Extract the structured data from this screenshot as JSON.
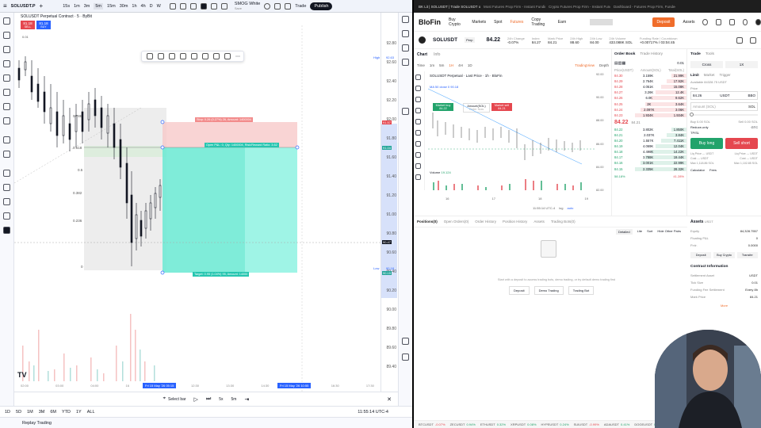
{
  "left": {
    "symbol": "SOLUSDT.P",
    "timeframes": [
      "15s",
      "1m",
      "3m",
      "5m",
      "15m",
      "30m",
      "1h",
      "4h",
      "D",
      "W"
    ],
    "template": "SMOG White",
    "template_sub": "Save",
    "trade_label": "Trade",
    "publish_label": "Publish",
    "legend_title": "SOLUSDT Perpetual Contract · 5 · ByBit",
    "sell_price": "81.18",
    "sell_label": "SELL",
    "buy_price": "81.18",
    "buy_label": "BUY",
    "spread": "0.01",
    "price_labels": [
      "92.80",
      "92.60",
      "92.40",
      "92.20",
      "92.00",
      "91.80",
      "91.60",
      "91.40",
      "91.20",
      "91.00",
      "90.80",
      "90.60",
      "90.40",
      "90.20",
      "90.00",
      "89.80",
      "89.60",
      "89.40"
    ],
    "high_label": "High",
    "high_price": "92.63",
    "low_label": "Low",
    "low_price": "90.18",
    "tag_prices": [
      "91.57",
      "91.04",
      "90.47",
      "90.15"
    ],
    "fib_levels": [
      "0.786",
      "0.618",
      "0.5",
      "0.382",
      "0.236",
      "0"
    ],
    "stop_text": "Stop: 0.26 (0.27%) 26, Amount: 1400004",
    "target_text": "Target: 0.95 (1.04%) 95, Amount: 14000",
    "open_text": "Open P&L: 0, Qty: 1400004, Risk/Reward Ratio: 3.62",
    "time_labels": [
      "02:00",
      "02:30",
      "03:00",
      "03:30",
      "04:00",
      "16",
      "11:00",
      "11:30",
      "12:00",
      "12:30",
      "13:00",
      "13:30",
      "14:00",
      "14:30",
      "15:00",
      "15:30",
      "16:00",
      "16:30",
      "17:00",
      "17:30",
      "18:00"
    ],
    "date_tag1": "Fri 15 May '26  05:15",
    "date_tag2": "Fri 15 May '26  10:55",
    "select_bar": "Select bar",
    "speed": "5x",
    "interval": "5m",
    "range_btns": [
      "1D",
      "5D",
      "1M",
      "3M",
      "6M",
      "YTD",
      "1Y",
      "ALL"
    ],
    "clock": "11:55:14 UTC-4",
    "replay": "Replay Trading"
  },
  "browser_tabs": [
    "BK Lit | SOLUSDT | Trade SOLUSDT on BloFin Futures",
    "Most Futures Prop Firm - Instant Funding & Daily Payouts",
    "Crypto Futures Prop Firm - Instant Funding & Daily Payouts",
    "Dashboard - Futures Prop Firm, Funded Accounts & More"
  ],
  "right": {
    "brand": "BloFin",
    "nav": [
      "Buy Crypto",
      "Markets",
      "Spot",
      "Futures",
      "Copy Trading",
      "Earn"
    ],
    "deposit": "Deposit",
    "assets_nav": "Assets",
    "pair": "SOLUSDT",
    "pair_type": "Perp",
    "last": "84.22",
    "stats": [
      {
        "l": "24h Change",
        "v": "-0.07%",
        "c": "red"
      },
      {
        "l": "Index",
        "v": "84.27",
        "c": ""
      },
      {
        "l": "Mark Price",
        "v": "84.21",
        "c": ""
      },
      {
        "l": "24h High",
        "v": "88.60",
        "c": ""
      },
      {
        "l": "24h Low",
        "v": "84.00",
        "c": ""
      },
      {
        "l": "24h Volume",
        "v": "433.088K SOL",
        "c": ""
      },
      {
        "l": "Funding Rate / Countdown",
        "v": "+0.00717% / 03:04:45",
        "c": ""
      }
    ],
    "chart_tabs": [
      "Chart",
      "Info"
    ],
    "chart_intervals": [
      "Time",
      "1m",
      "5m",
      "1H",
      "4H",
      "1D"
    ],
    "tradingview": "TradingView",
    "depth": "Depth",
    "chart_legend": "SOLUSDT Perpetual · Last Price · 1h · BloFin",
    "ma": "MA 50 close 0  90.18",
    "market_buy": "Market buy",
    "market_buy_price": "84.22",
    "amount_label": "Amount(SOL)",
    "order_now": "Order Now",
    "market_sell": "Market sell",
    "market_sell_price": "84.21",
    "volume": "Volume",
    "volume_val": "19.124",
    "chart_prices": [
      "92.00",
      "91.00",
      "90.00",
      "89.00",
      "88.00",
      "87.00",
      "86.00",
      "85.00",
      "84.00",
      "83.00",
      "82.00",
      "81.00"
    ],
    "chart_dates": [
      "16",
      "17",
      "18",
      "19"
    ],
    "chart_clock": "11:55:14 UTC-4",
    "log": "log",
    "auto": "auto",
    "ob_tabs": [
      "Order Book",
      "Trade History"
    ],
    "ob_step": "0.01",
    "ob_headers": [
      "Price(USDT)",
      "Amount(SOL)",
      "Total(SOL)"
    ],
    "asks": [
      [
        "84.30",
        "3.159K",
        "21.99K"
      ],
      [
        "84.29",
        "2.764K",
        "17.92K"
      ],
      [
        "84.28",
        "4.051K",
        "15.08K"
      ],
      [
        "84.27",
        "3.26K",
        "12.4K"
      ],
      [
        "84.26",
        "6.0K",
        "9.62K"
      ],
      [
        "84.25",
        "2K",
        "3.64K"
      ],
      [
        "84.24",
        "2.097K",
        "3.06K"
      ],
      [
        "84.23",
        "1.934K",
        "1.934K"
      ]
    ],
    "mid": "84.22",
    "mid_mark": "84.21",
    "bids": [
      [
        "84.22",
        "3.802K",
        "1.850K"
      ],
      [
        "84.21",
        "2.037K",
        "3.84K"
      ],
      [
        "84.20",
        "1.557K",
        "7.411K"
      ],
      [
        "84.19",
        "4.069K",
        "12.04K"
      ],
      [
        "84.18",
        "4.498K",
        "14.22K"
      ],
      [
        "84.17",
        "3.788K",
        "19.44K"
      ],
      [
        "84.16",
        "3.001K",
        "22.99K"
      ],
      [
        "84.15",
        "2.335K",
        "28.32K"
      ]
    ],
    "ob_buy_pct": "58.18%",
    "ob_sell_pct": "41.28%",
    "trade_tabs": [
      "Trade",
      "Tools"
    ],
    "margin_modes": [
      "Cross",
      "1X"
    ],
    "order_types": [
      "Limit",
      "Market",
      "Trigger"
    ],
    "available": "Available 84328.75 USDT",
    "price_lbl": "Price",
    "price_val": "84.26",
    "price_unit": "USDT",
    "bbo": "BBO",
    "amount_lbl": "Amount (SOL)",
    "amount_unit": "SOL",
    "buy_cost": "Buy 0.00 SOL",
    "sell_cost": "Sell 0.00 SOL",
    "reduce_only": "Reduce-only",
    "gtc": "GTC",
    "tpsl": "TP/SL",
    "buy_long": "Buy long",
    "sell_short": "Sell short",
    "liq_buy": "Liq Price --- USDT",
    "liq_sell": "Liq Price --- USDT",
    "cost_buy": "Cost --- USDT",
    "cost_sell": "Cost --- USDT",
    "max_buy": "Max 1,118.86 SOL",
    "max_sell": "Max 1,102.85 SOL",
    "calc": "Calculator",
    "fees": "Fees",
    "pos_tabs": [
      "Positions(0)",
      "Open Orders(0)",
      "Order History",
      "Position History",
      "Assets",
      "Trading Bots(0)"
    ],
    "pos_opts": [
      "Detailed",
      "Lite",
      "Sort",
      "Hide Other Pairs"
    ],
    "empty_msg": "Start with a deposit to access trading bots, demo trading, or try default demo trading first",
    "empty_btns": [
      "Deposit",
      "Demo Trading",
      "Trading Bot"
    ],
    "assets_title": "Assets",
    "assets_ccy": "USDT",
    "asset_rows": [
      [
        "Equity",
        "84,328.7557"
      ],
      [
        "Floating P&L",
        "0"
      ],
      [
        "P.nlr.",
        "0.0000"
      ]
    ],
    "asset_btns": [
      "Deposit",
      "Buy Crypto",
      "Transfer"
    ],
    "contract_title": "Contract Information",
    "contract_rows": [
      [
        "Settlement Asset",
        "USDT"
      ],
      [
        "Tick Size",
        "0.01"
      ],
      [
        "Funding Fee Settlement",
        "Every 8h"
      ],
      [
        "Mark Price",
        "84.21"
      ]
    ],
    "more": "More",
    "footer": [
      [
        "BTCUSDT",
        "-0.07%"
      ],
      [
        "ZECUSDT",
        "0.94%"
      ],
      [
        "ETHUSDT",
        "0.32%"
      ],
      [
        "XRPUSDT",
        "0.08%"
      ],
      [
        "HYPEUSDT",
        "0.24%"
      ],
      [
        "SUIUSDT",
        "-0.99%"
      ],
      [
        "ADAUSDT",
        "0.41%"
      ],
      [
        "DOGEUSDT",
        "0.21%"
      ],
      [
        "BNBUSDT",
        "0.13%"
      ]
    ]
  }
}
